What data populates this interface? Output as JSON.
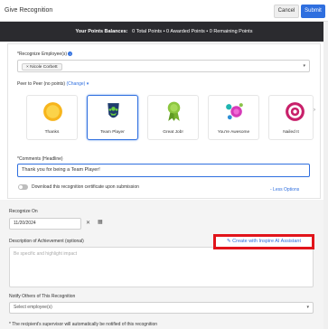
{
  "header": {
    "title": "Give Recognition",
    "cancel": "Cancel",
    "submit": "Submit"
  },
  "points": {
    "label": "Your Points Balances:",
    "total": "0 Total Points",
    "awarded": "0 Awarded Points",
    "remaining": "0 Remaining Points",
    "sep": "•"
  },
  "recognize": {
    "label": "*Recognize Employee(s)",
    "chip": "× Nicole Corbett"
  },
  "peer": {
    "label": "Peer to Peer (no points)",
    "change": "(Change)"
  },
  "badges": [
    {
      "label": "Thanks"
    },
    {
      "label": "Team Player"
    },
    {
      "label": "Great Job!"
    },
    {
      "label": "You're Awesome"
    },
    {
      "label": "Nailed It"
    }
  ],
  "comments": {
    "label": "*Comments (Headline)",
    "value": "Thank you for being a Team Player!"
  },
  "download": {
    "label": "Download this recognition certificate upon submission"
  },
  "less_options": "- Less Options",
  "recognize_on": {
    "label": "Recognize On",
    "value": "11/20/2024"
  },
  "description": {
    "label": "Description of Achievement (optional)",
    "placeholder": "Be specific and highlight impact"
  },
  "ai_assistant": "Create with Inspire AI Assistant",
  "notify": {
    "label": "Notify Others of This Recognition",
    "placeholder": "Select employee(s)"
  },
  "note": "* The recipient's supervisor will automatically be notified of this recognition",
  "colors": {
    "accent": "#2f6fdf",
    "dark_bar": "#2b2b2f",
    "highlight": "#e1141b"
  }
}
